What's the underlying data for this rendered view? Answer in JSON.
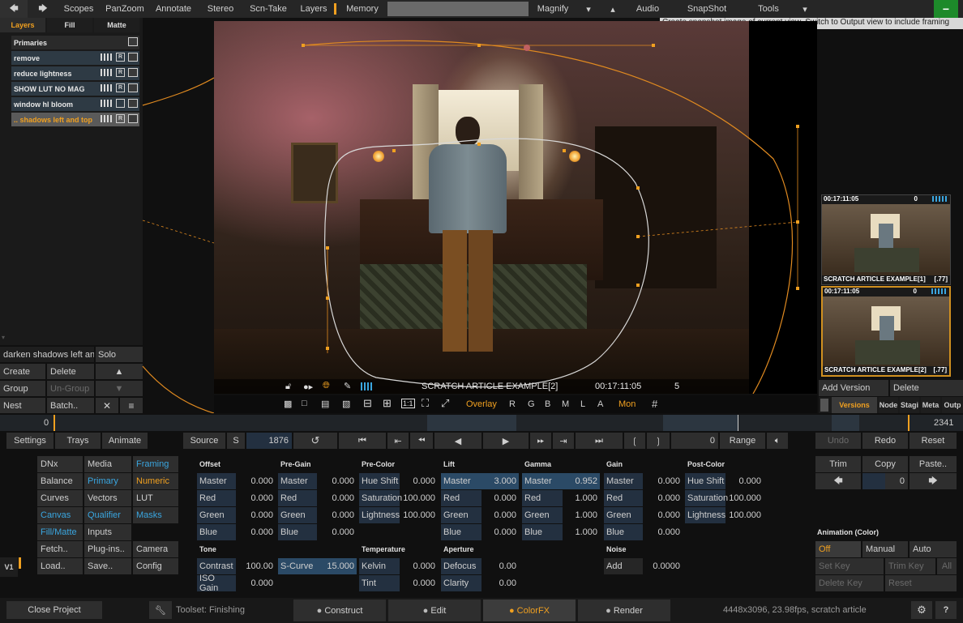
{
  "topbar": {
    "back_icon": "back-arrow-icon",
    "forward_icon": "forward-arrow-icon",
    "items": [
      "Scopes",
      "PanZoom",
      "Annotate",
      "Stereo",
      "Scn-Take",
      "Layers",
      "Memory"
    ],
    "magnify": "Magnify",
    "audio": "Audio",
    "snapshot": "SnapShot",
    "tools": "Tools",
    "minimize": "−",
    "tooltip": "Create snapshot image of current view. Switch to Output view to include framing"
  },
  "layers": {
    "tabs": [
      "Layers",
      "Fill",
      "Matte"
    ],
    "primaries": "Primaries",
    "rows": [
      {
        "name": "remove"
      },
      {
        "name": "reduce lightness"
      },
      {
        "name": "SHOW LUT NO MAG"
      },
      {
        "name": "window hl bloom"
      },
      {
        "name": ".. shadows left and top"
      }
    ],
    "r_label": "R",
    "current_name": "darken shadows left and",
    "solo": "Solo",
    "create": "Create",
    "delete": "Delete",
    "group": "Group",
    "ungroup": "Un-Group",
    "nest": "Nest",
    "batch": "Batch..",
    "close": "✕",
    "menu": "≡"
  },
  "viewer": {
    "clip_name": "SCRATCH ARTICLE EXAMPLE[2]",
    "timecode": "00:17:11:05",
    "count": "5",
    "overlay": "Overlay",
    "channels": [
      "R",
      "G",
      "B",
      "M",
      "L",
      "A"
    ],
    "mon": "Mon",
    "grid": "#",
    "one_to_one": "1:1"
  },
  "versions": {
    "thumbs": [
      {
        "tc": "00:17:11:05",
        "num": "0",
        "name": "SCRATCH ARTICLE EXAMPLE[1]",
        "ver": "[.77]"
      },
      {
        "tc": "00:17:11:05",
        "num": "0",
        "name": "SCRATCH ARTICLE EXAMPLE[2]",
        "ver": "[.77]"
      }
    ],
    "add_version": "Add Version",
    "delete": "Delete",
    "tabs": [
      "Versions",
      "Node",
      "Stagi",
      "Meta",
      "Outp"
    ]
  },
  "timeline": {
    "start": "0",
    "end": "2341"
  },
  "transport": {
    "settings": "Settings",
    "trays": "Trays",
    "animate": "Animate",
    "source": "Source",
    "s": "S",
    "frame": "1876",
    "zero": "0",
    "range": "Range",
    "undo": "Undo",
    "redo": "Redo",
    "reset": "Reset"
  },
  "menu_grid": [
    [
      "DNx",
      "Media",
      "Framing"
    ],
    [
      "Balance",
      "Primary",
      "Numeric"
    ],
    [
      "Curves",
      "Vectors",
      "LUT"
    ],
    [
      "Canvas",
      "Qualifier",
      "Masks"
    ],
    [
      "Fill/Matte",
      "Inputs",
      ""
    ],
    [
      "Fetch..",
      "Plug-ins..",
      "Camera"
    ],
    [
      "Load..",
      "Save..",
      "Config"
    ]
  ],
  "v1": "V1",
  "params": {
    "offset": {
      "title": "Offset",
      "rows": [
        [
          "Master",
          "0.000"
        ],
        [
          "Red",
          "0.000"
        ],
        [
          "Green",
          "0.000"
        ],
        [
          "Blue",
          "0.000"
        ]
      ]
    },
    "pregain": {
      "title": "Pre-Gain",
      "rows": [
        [
          "Master",
          "0.000"
        ],
        [
          "Red",
          "0.000"
        ],
        [
          "Green",
          "0.000"
        ],
        [
          "Blue",
          "0.000"
        ]
      ]
    },
    "precolor": {
      "title": "Pre-Color",
      "rows": [
        [
          "Hue Shift",
          "0.000"
        ],
        [
          "Saturation",
          "100.000"
        ],
        [
          "Lightness",
          "100.000"
        ]
      ]
    },
    "lift": {
      "title": "Lift",
      "rows": [
        [
          "Master",
          "3.000"
        ],
        [
          "Red",
          "0.000"
        ],
        [
          "Green",
          "0.000"
        ],
        [
          "Blue",
          "0.000"
        ]
      ]
    },
    "gamma": {
      "title": "Gamma",
      "rows": [
        [
          "Master",
          "0.952"
        ],
        [
          "Red",
          "1.000"
        ],
        [
          "Green",
          "1.000"
        ],
        [
          "Blue",
          "1.000"
        ]
      ]
    },
    "gain": {
      "title": "Gain",
      "rows": [
        [
          "Master",
          "0.000"
        ],
        [
          "Red",
          "0.000"
        ],
        [
          "Green",
          "0.000"
        ],
        [
          "Blue",
          "0.000"
        ]
      ]
    },
    "postcolor": {
      "title": "Post-Color",
      "rows": [
        [
          "Hue Shift",
          "0.000"
        ],
        [
          "Saturation",
          "100.000"
        ],
        [
          "Lightness",
          "100.000"
        ]
      ]
    },
    "tone": {
      "title": "Tone",
      "contrast": "Contrast",
      "contrast_val": "100.00",
      "scurve": "S-Curve",
      "scurve_val": "15.000",
      "iso": "ISO Gain",
      "iso_val": "0.000"
    },
    "temperature": {
      "title": "Temperature",
      "kelvin": "Kelvin",
      "kelvin_val": "0.000",
      "tint": "Tint",
      "tint_val": "0.000"
    },
    "aperture": {
      "title": "Aperture",
      "defocus": "Defocus",
      "defocus_val": "0.00",
      "clarity": "Clarity",
      "clarity_val": "0.00"
    },
    "noise": {
      "title": "Noise",
      "add": "Add",
      "add_val": "0.0000"
    }
  },
  "right_controls": {
    "trim": "Trim",
    "copy": "Copy",
    "paste": "Paste..",
    "copy_val": "0",
    "animation_title": "Animation (Color)",
    "off": "Off",
    "manual": "Manual",
    "auto": "Auto",
    "set_key": "Set Key",
    "trim_key": "Trim Key",
    "all": "All",
    "delete_key": "Delete Key",
    "reset": "Reset"
  },
  "statusbar": {
    "close_project": "Close Project",
    "toolset": "Toolset: Finishing",
    "tabs": [
      "Construct",
      "Edit",
      "ColorFX",
      "Render"
    ],
    "info": "4448x3096, 23.98fps, scratch article",
    "help": "?"
  }
}
